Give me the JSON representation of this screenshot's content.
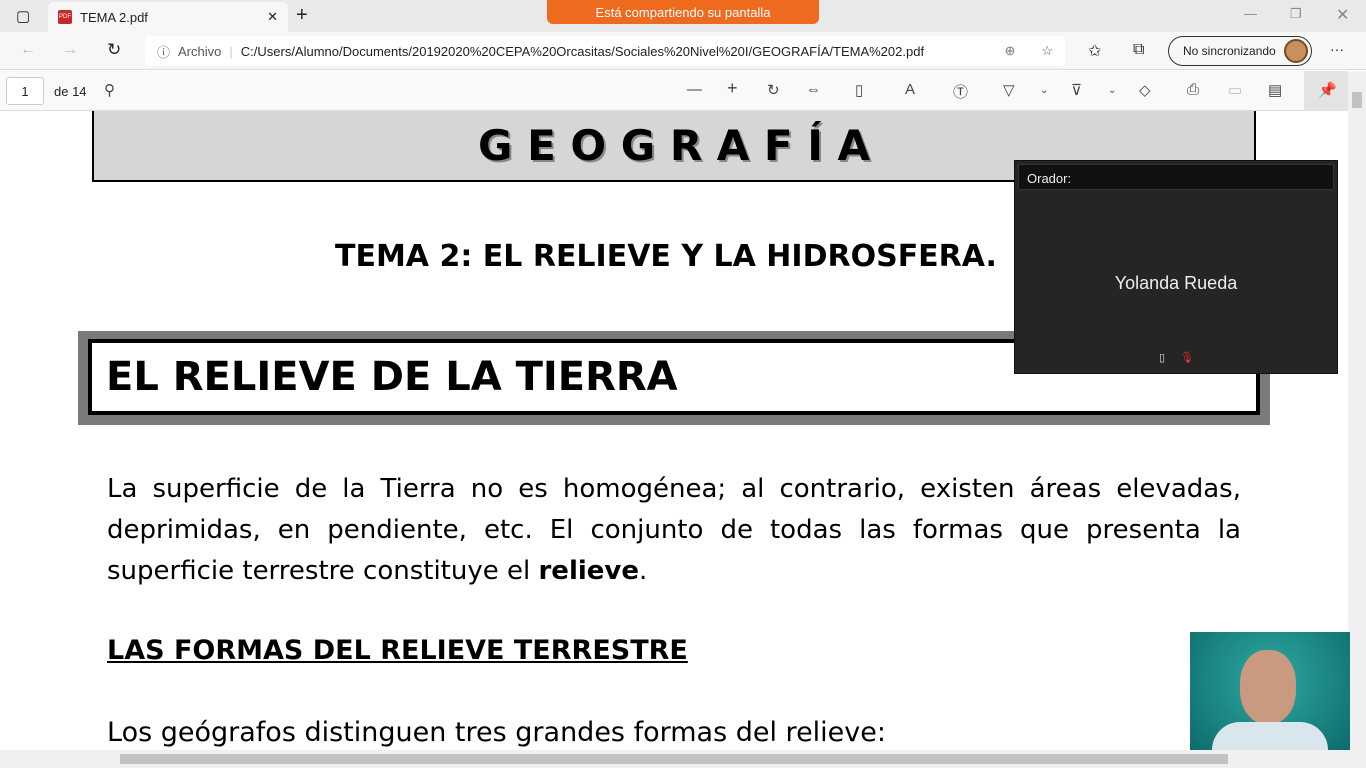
{
  "browser": {
    "tab_title": "TEMA 2.pdf",
    "share_banner": "Está compartiendo su pantalla",
    "address_label": "Archivo",
    "url": "C:/Users/Alumno/Documents/20192020%20CEPA%20Orcasitas/Sociales%20Nivel%20I/GEOGRAFÍA/TEMA%202.pdf",
    "sync_label": "No sincronizando"
  },
  "pdf": {
    "page": "1",
    "page_total": "de 14"
  },
  "doc": {
    "header": "G E O G R A F Í A",
    "tema": "TEMA 2: EL RELIEVE Y LA HIDROSFERA.",
    "section": "EL RELIEVE DE LA TIERRA",
    "para_start": "La superficie de la Tierra no es homogénea; al contrario, existen áreas elevadas, deprimidas, en pendiente, etc. El conjunto de todas las formas que presenta la superficie terrestre constituye el ",
    "para_bold": "relieve",
    "para_end": ".",
    "subheading": "LAS FORMAS DEL RELIEVE TERRESTRE",
    "line": "Los geógrafos distinguen tres grandes formas del relieve:"
  },
  "speaker": {
    "label": "Orador:",
    "name": "Yolanda Rueda"
  }
}
